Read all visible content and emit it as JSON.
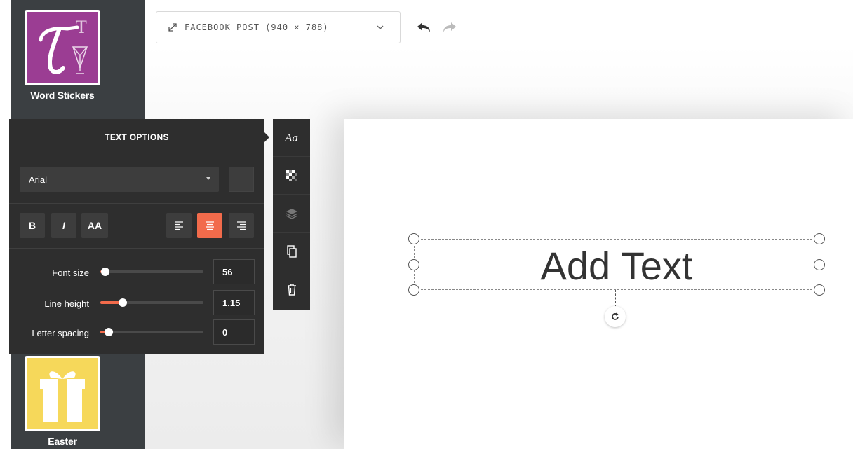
{
  "sidebar": {
    "stickers": [
      {
        "label": "Word Stickers",
        "icon": "word-stickers-icon"
      },
      {
        "label": "Easter",
        "icon": "gift-icon"
      }
    ]
  },
  "topbar": {
    "size_select": "FACEBOOK POST (940 × 788)",
    "undo_icon": "undo-icon",
    "redo_icon": "redo-icon"
  },
  "canvas": {
    "text": "Add Text"
  },
  "text_options": {
    "title": "TEXT OPTIONS",
    "font": "Arial",
    "bold_label": "B",
    "italic_label": "I",
    "case_label": "AA",
    "align_active": "center",
    "font_size": {
      "label": "Font size",
      "value": "56",
      "level": 0.05
    },
    "line_height": {
      "label": "Line height",
      "value": "1.15",
      "level": 0.22
    },
    "letter_spacing": {
      "label": "Letter spacing",
      "value": "0",
      "level": 0.08
    }
  },
  "toolbar": {
    "items": [
      "Aa",
      "transparency-icon",
      "layers-icon",
      "duplicate-icon",
      "trash-icon"
    ]
  },
  "colors": {
    "accent": "#f26b4b",
    "panel": "#2e2e2e",
    "sidebar": "#3b3f42",
    "word_stickers_bg": "#9b3d93",
    "easter_bg": "#f6d85a"
  }
}
